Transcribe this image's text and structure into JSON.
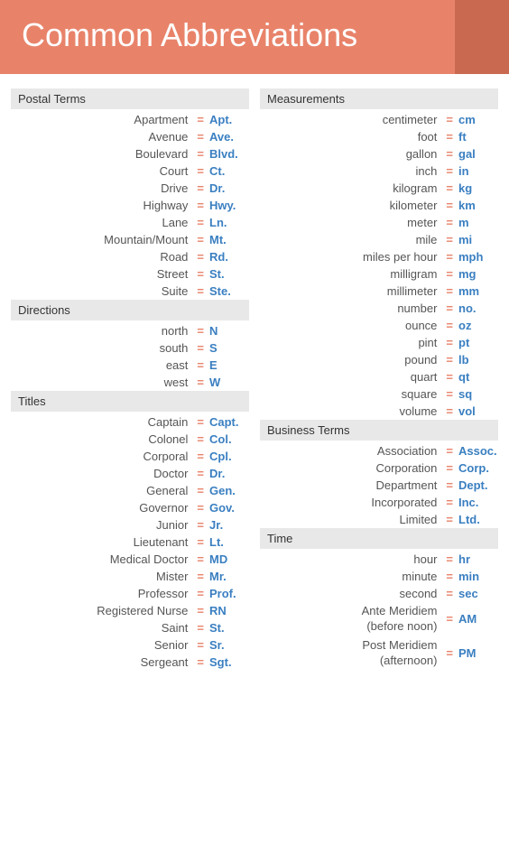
{
  "header": {
    "title": "Common Abbreviations"
  },
  "left": {
    "sections": [
      {
        "label": "Postal Terms",
        "items": [
          {
            "term": "Apartment",
            "eq": "=",
            "abbrev": "Apt."
          },
          {
            "term": "Avenue",
            "eq": "=",
            "abbrev": "Ave."
          },
          {
            "term": "Boulevard",
            "eq": "=",
            "abbrev": "Blvd."
          },
          {
            "term": "Court",
            "eq": "=",
            "abbrev": "Ct."
          },
          {
            "term": "Drive",
            "eq": "=",
            "abbrev": "Dr."
          },
          {
            "term": "Highway",
            "eq": "=",
            "abbrev": "Hwy."
          },
          {
            "term": "Lane",
            "eq": "=",
            "abbrev": "Ln."
          },
          {
            "term": "Mountain/Mount",
            "eq": "=",
            "abbrev": "Mt."
          },
          {
            "term": "Road",
            "eq": "=",
            "abbrev": "Rd."
          },
          {
            "term": "Street",
            "eq": "=",
            "abbrev": "St."
          },
          {
            "term": "Suite",
            "eq": "=",
            "abbrev": "Ste."
          }
        ]
      },
      {
        "label": "Directions",
        "items": [
          {
            "term": "north",
            "eq": "=",
            "abbrev": "N"
          },
          {
            "term": "south",
            "eq": "=",
            "abbrev": "S"
          },
          {
            "term": "east",
            "eq": "=",
            "abbrev": "E"
          },
          {
            "term": "west",
            "eq": "=",
            "abbrev": "W"
          }
        ]
      },
      {
        "label": "Titles",
        "items": [
          {
            "term": "Captain",
            "eq": "=",
            "abbrev": "Capt."
          },
          {
            "term": "Colonel",
            "eq": "=",
            "abbrev": "Col."
          },
          {
            "term": "Corporal",
            "eq": "=",
            "abbrev": "Cpl."
          },
          {
            "term": "Doctor",
            "eq": "=",
            "abbrev": "Dr."
          },
          {
            "term": "General",
            "eq": "=",
            "abbrev": "Gen."
          },
          {
            "term": "Governor",
            "eq": "=",
            "abbrev": "Gov."
          },
          {
            "term": "Junior",
            "eq": "=",
            "abbrev": "Jr."
          },
          {
            "term": "Lieutenant",
            "eq": "=",
            "abbrev": "Lt."
          },
          {
            "term": "Medical Doctor",
            "eq": "=",
            "abbrev": "MD"
          },
          {
            "term": "Mister",
            "eq": "=",
            "abbrev": "Mr."
          },
          {
            "term": "Professor",
            "eq": "=",
            "abbrev": "Prof."
          },
          {
            "term": "Registered Nurse",
            "eq": "=",
            "abbrev": "RN"
          },
          {
            "term": "Saint",
            "eq": "=",
            "abbrev": "St."
          },
          {
            "term": "Senior",
            "eq": "=",
            "abbrev": "Sr."
          },
          {
            "term": "Sergeant",
            "eq": "=",
            "abbrev": "Sgt."
          }
        ]
      }
    ]
  },
  "right": {
    "sections": [
      {
        "label": "Measurements",
        "items": [
          {
            "term": "centimeter",
            "eq": "=",
            "abbrev": "cm"
          },
          {
            "term": "foot",
            "eq": "=",
            "abbrev": "ft"
          },
          {
            "term": "gallon",
            "eq": "=",
            "abbrev": "gal"
          },
          {
            "term": "inch",
            "eq": "=",
            "abbrev": "in"
          },
          {
            "term": "kilogram",
            "eq": "=",
            "abbrev": "kg"
          },
          {
            "term": "kilometer",
            "eq": "=",
            "abbrev": "km"
          },
          {
            "term": "meter",
            "eq": "=",
            "abbrev": "m"
          },
          {
            "term": "mile",
            "eq": "=",
            "abbrev": "mi"
          },
          {
            "term": "miles per hour",
            "eq": "=",
            "abbrev": "mph"
          },
          {
            "term": "milligram",
            "eq": "=",
            "abbrev": "mg"
          },
          {
            "term": "millimeter",
            "eq": "=",
            "abbrev": "mm"
          },
          {
            "term": "number",
            "eq": "=",
            "abbrev": "no."
          },
          {
            "term": "ounce",
            "eq": "=",
            "abbrev": "oz"
          },
          {
            "term": "pint",
            "eq": "=",
            "abbrev": "pt"
          },
          {
            "term": "pound",
            "eq": "=",
            "abbrev": "lb"
          },
          {
            "term": "quart",
            "eq": "=",
            "abbrev": "qt"
          },
          {
            "term": "square",
            "eq": "=",
            "abbrev": "sq"
          },
          {
            "term": "volume",
            "eq": "=",
            "abbrev": "vol"
          }
        ]
      },
      {
        "label": "Business Terms",
        "items": [
          {
            "term": "Association",
            "eq": "=",
            "abbrev": "Assoc."
          },
          {
            "term": "Corporation",
            "eq": "=",
            "abbrev": "Corp."
          },
          {
            "term": "Department",
            "eq": "=",
            "abbrev": "Dept."
          },
          {
            "term": "Incorporated",
            "eq": "=",
            "abbrev": "Inc."
          },
          {
            "term": "Limited",
            "eq": "=",
            "abbrev": "Ltd."
          }
        ]
      },
      {
        "label": "Time",
        "items": [
          {
            "term": "hour",
            "eq": "=",
            "abbrev": "hr"
          },
          {
            "term": "minute",
            "eq": "=",
            "abbrev": "min"
          },
          {
            "term": "second",
            "eq": "=",
            "abbrev": "sec"
          },
          {
            "term": "Ante Meridiem\n(before noon)",
            "eq": "=",
            "abbrev": "AM",
            "multiline": true
          },
          {
            "term": "Post Meridiem\n(afternoon)",
            "eq": "=",
            "abbrev": "PM",
            "multiline": true
          }
        ]
      }
    ]
  },
  "eq_symbol": "=",
  "colors": {
    "header_bg": "#e8836a",
    "section_bg": "#e8e8e8",
    "term_color": "#555555",
    "eq_color": "#e8836a",
    "abbrev_color": "#3a7fc1"
  }
}
